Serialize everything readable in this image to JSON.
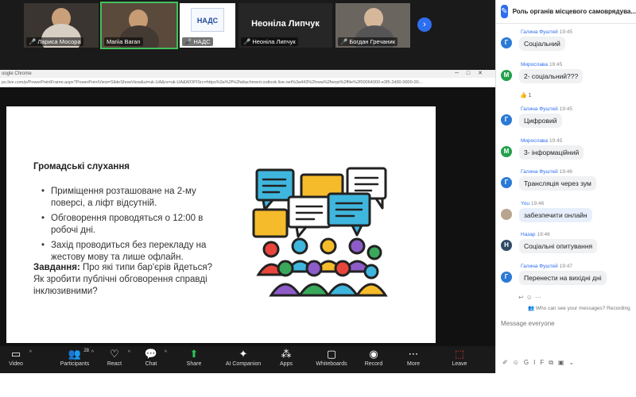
{
  "participants_strip": [
    {
      "name": "Лариса Мосора",
      "muted": true
    },
    {
      "name": "Mariia Baran",
      "muted": false,
      "active": true
    },
    {
      "name": "НАДС",
      "muted": true,
      "logo": "НАДС"
    },
    {
      "name": "Неоніла Липчук",
      "muted": true,
      "big_name": "Неоніла Липчук"
    },
    {
      "name": "Богдан Гречаник",
      "muted": true
    }
  ],
  "browser": {
    "title": "oogle Chrome",
    "url": "ps.live.com/p/PowerPointFrame.aspx?PowerPointView=SlideShowView&ui=uk-UA&rs=uk-UA&WOPISrc=https%3a%2f%2fattachment.outlook.live.net%3a443%2fowa%2fwopi%2ffile%2f00064000-e3f5-2d90-0000-00..."
  },
  "slide": {
    "title": "Громадські слухання",
    "bullets": [
      "Приміщення розташоване на 2-му поверсі, а ліфт відсутній.",
      "Обговорення проводяться о 12:00 в робочі дні.",
      "Захід проводиться без перекладу на жестову мову та лише офлайн."
    ],
    "task_label": "Завдання:",
    "task_text": " Про які типи бар'єрів йдеться? Як зробити публічні обговорення справді інклюзивними?"
  },
  "toolbar": {
    "video": "Video",
    "participants": "Participants",
    "participants_count": "28",
    "react": "React",
    "chat": "Chat",
    "share": "Share",
    "ai": "AI Companion",
    "apps": "Apps",
    "whiteboards": "Whiteboards",
    "record": "Record",
    "more": "More",
    "leave": "Leave"
  },
  "chat": {
    "title": "Роль органів місцевого самоврядува...",
    "messages": [
      {
        "sender": "Галина Фуштей",
        "time": "19:45",
        "text": "Соціальний",
        "initial": "Г",
        "color": "#2a7ad6"
      },
      {
        "sender": "Мирослава",
        "time": "19:45",
        "text": "2- соціальний???",
        "initial": "М",
        "color": "#23a04a"
      },
      {
        "sender": "Галина Фуштей",
        "time": "19:45",
        "text": "Цифровий",
        "initial": "Г",
        "color": "#2a7ad6"
      },
      {
        "sender": "Мирослава",
        "time": "19:45",
        "text": "3- інформаційний",
        "initial": "М",
        "color": "#23a04a"
      },
      {
        "sender": "Галина Фуштей",
        "time": "19:46",
        "text": "Трансляція через зум",
        "initial": "Г",
        "color": "#2a7ad6"
      },
      {
        "sender": "You",
        "time": "19:46",
        "text": "забезпечити онлайн",
        "initial": "",
        "color": "#b9a58f",
        "me": true
      },
      {
        "sender": "Назар",
        "time": "19:46",
        "text": "Соціальні опитування",
        "initial": "Н",
        "color": "#2e4a66"
      },
      {
        "sender": "Галина Фуштей",
        "time": "19:47",
        "text": "Перенести на вихідні дні",
        "initial": "Г",
        "color": "#2a7ad6"
      }
    ],
    "reaction_count": "1",
    "privacy_note": "Who can see your messages? Recording",
    "input_placeholder": "Message everyone"
  }
}
